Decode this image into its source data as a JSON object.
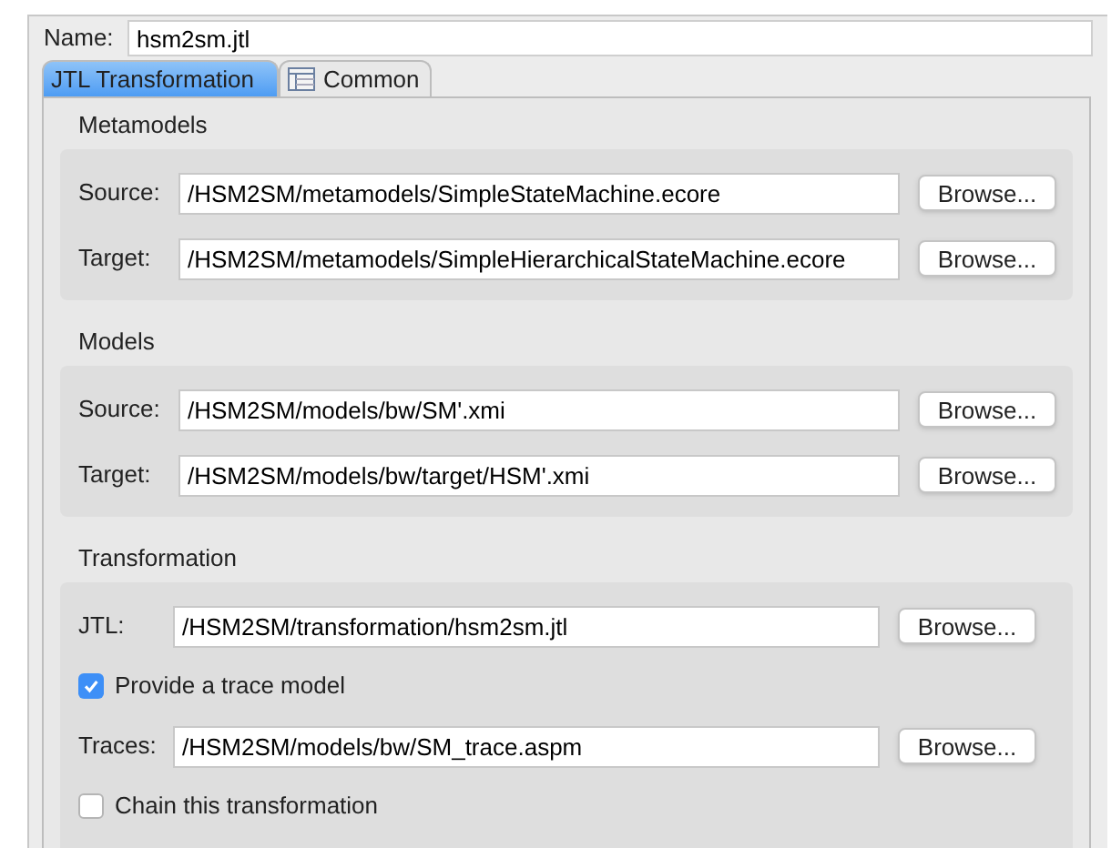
{
  "name_field": {
    "label": "Name:",
    "value": "hsm2sm.jtl"
  },
  "tabs": [
    {
      "label": "JTL Transformation",
      "selected": true,
      "icon": false
    },
    {
      "label": "Common",
      "selected": false,
      "icon": true
    }
  ],
  "groups": [
    {
      "title": "Metamodels",
      "rows": [
        {
          "kind": "path",
          "label": "Source:",
          "value": "/HSM2SM/metamodels/SimpleStateMachine.ecore",
          "button": "Browse..."
        },
        {
          "kind": "path",
          "label": "Target:",
          "value": "/HSM2SM/metamodels/SimpleHierarchicalStateMachine.ecore",
          "button": "Browse..."
        }
      ]
    },
    {
      "title": "Models",
      "rows": [
        {
          "kind": "path",
          "label": "Source:",
          "value": "/HSM2SM/models/bw/SM'.xmi",
          "button": "Browse..."
        },
        {
          "kind": "path",
          "label": "Target:",
          "value": "/HSM2SM/models/bw/target/HSM'.xmi",
          "button": "Browse..."
        }
      ]
    },
    {
      "title": "Transformation",
      "narrow": true,
      "rows": [
        {
          "kind": "path",
          "label": "JTL:",
          "value": "/HSM2SM/transformation/hsm2sm.jtl",
          "button": "Browse..."
        },
        {
          "kind": "checkbox",
          "label": "Provide a trace model",
          "checked": true
        },
        {
          "kind": "path",
          "label": "Traces:",
          "value": "/HSM2SM/models/bw/SM_trace.aspm",
          "button": "Browse..."
        },
        {
          "kind": "checkbox",
          "label": "Chain this transformation",
          "checked": false
        }
      ]
    }
  ]
}
